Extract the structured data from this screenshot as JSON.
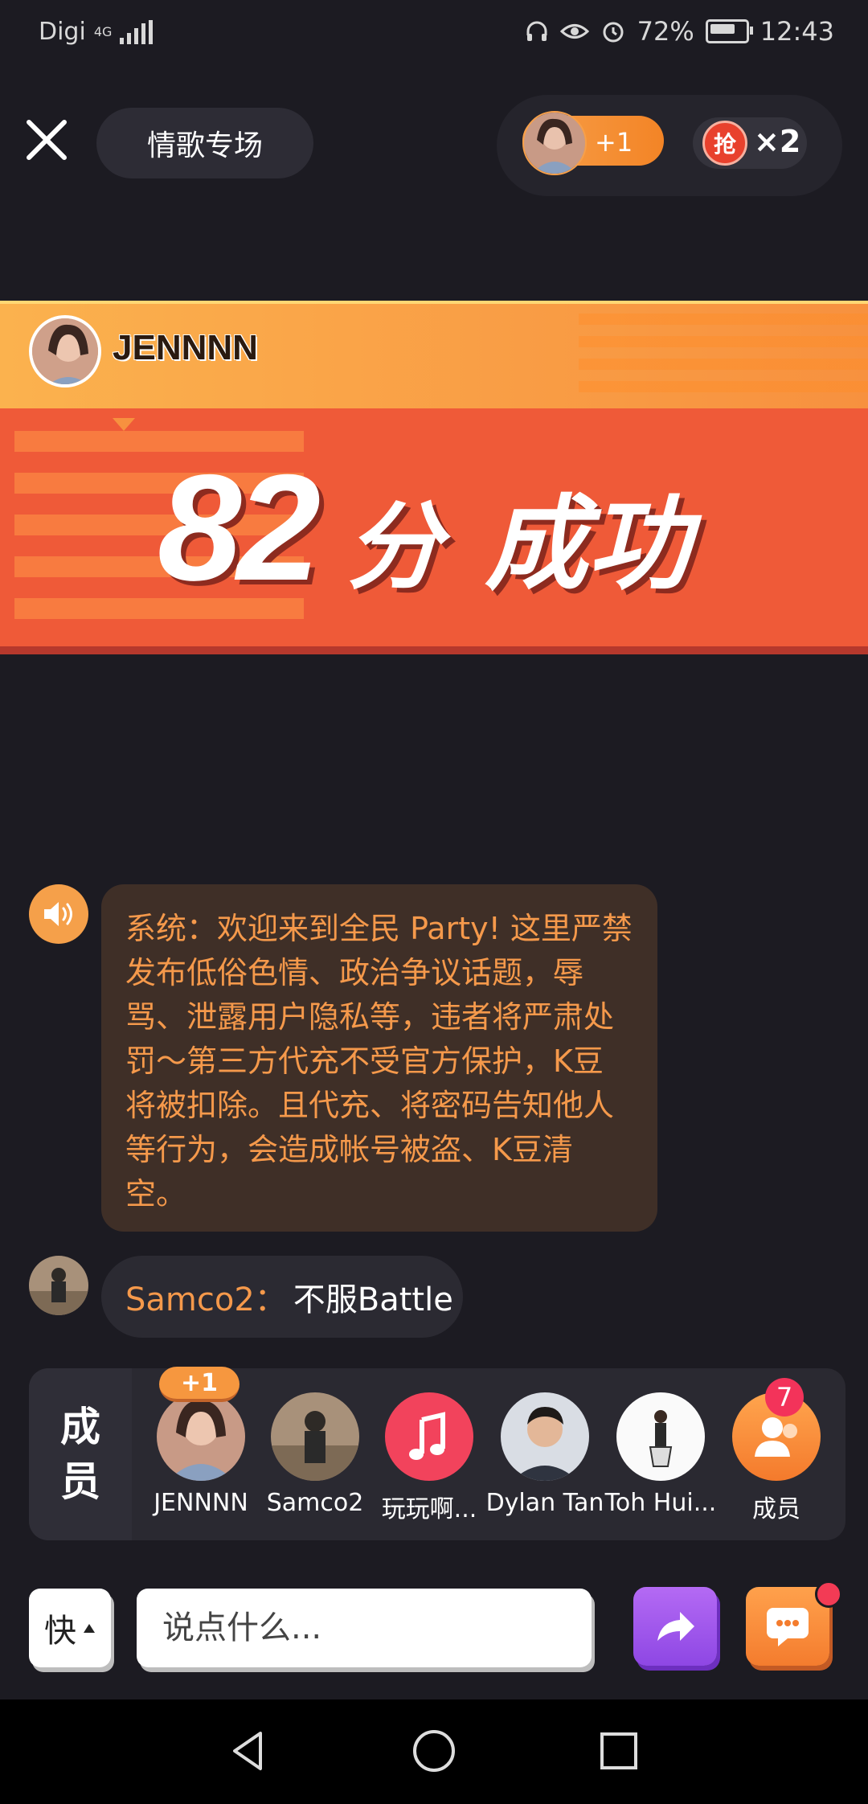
{
  "status_bar": {
    "carrier": "Digi",
    "network": "4G",
    "battery": "72%",
    "time": "12:43"
  },
  "top_bar": {
    "room_title": "情歌专场",
    "plus_one_label": "+1",
    "grab_badge": "抢",
    "grab_count": "×2"
  },
  "score_banner": {
    "singer_name": "JENNNN",
    "score": "82",
    "score_unit": "分",
    "status": "成功"
  },
  "chat": {
    "system_message": "系统：欢迎来到全民 Party! 这里严禁发布低俗色情、政治争议话题，辱骂、泄露用户隐私等，违者将严肃处罚～第三方代充不受官方保护，K豆将被扣除。且代充、将密码告知他人等行为，会造成帐号被盗、K豆清空。",
    "messages": [
      {
        "user": "Samco2：",
        "text": "不服Battle"
      }
    ]
  },
  "members": {
    "title_line1": "成",
    "title_line2": "员",
    "plus_one_tag": "+1",
    "list": [
      {
        "name": "JENNNN"
      },
      {
        "name": "Samco2"
      },
      {
        "name": "玩玩啊..."
      },
      {
        "name": "Dylan Tan"
      },
      {
        "name": "Toh Hui..."
      },
      {
        "name": "成员"
      }
    ],
    "member_count": "7"
  },
  "input_bar": {
    "fast_label": "快",
    "placeholder": "说点什么..."
  },
  "colors": {
    "background": "#1c1b22",
    "accent_orange": "#f5994b",
    "banner_red": "#ef5a38",
    "share_purple": "#9b55ea",
    "badge_pink": "#f3335a"
  },
  "icons": [
    "close-icon",
    "speaker-icon",
    "music-note-icon",
    "share-icon",
    "chat-icon",
    "back-icon",
    "home-icon",
    "recents-icon",
    "headphones-icon",
    "eye-icon",
    "alarm-icon"
  ]
}
